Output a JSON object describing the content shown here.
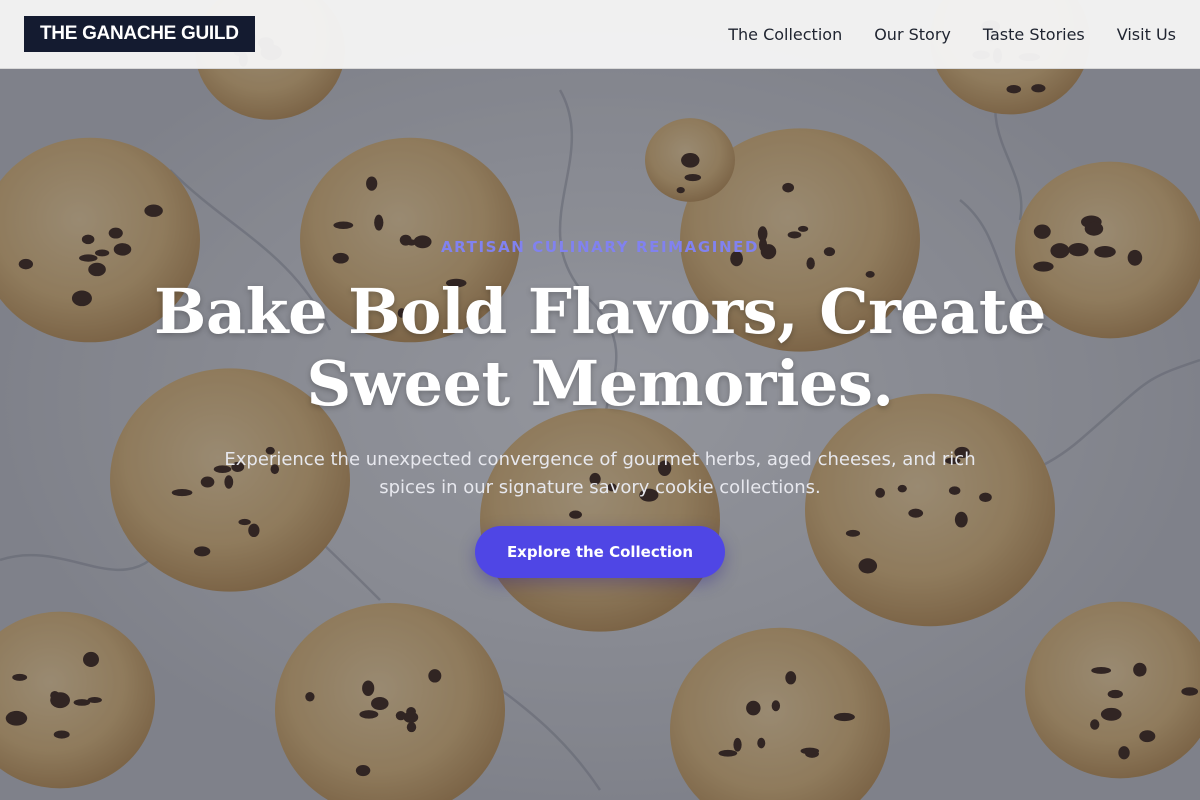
{
  "brand": {
    "name": "THE GANACHE GUILD"
  },
  "nav": {
    "items": [
      {
        "label": "The Collection"
      },
      {
        "label": "Our Story"
      },
      {
        "label": "Taste Stories"
      },
      {
        "label": "Visit Us"
      }
    ]
  },
  "hero": {
    "eyebrow": "ARTISAN CULINARY REIMAGINED",
    "headline_line1": "Bake Bold Flavors, Create",
    "headline_line2": "Sweet Memories.",
    "subtext_line1": "Experience the unexpected convergence of gourmet herbs, aged cheeses, and rich",
    "subtext_line2": "spices in our signature savory cookie collections.",
    "cta_label": "Explore the Collection",
    "background_image": "chocolate-chip-cookies-on-marble"
  },
  "colors": {
    "brand_bg": "#141b30",
    "accent": "#4f46e5",
    "eyebrow": "#8182ef",
    "header_bg": "#f5f5f5"
  }
}
